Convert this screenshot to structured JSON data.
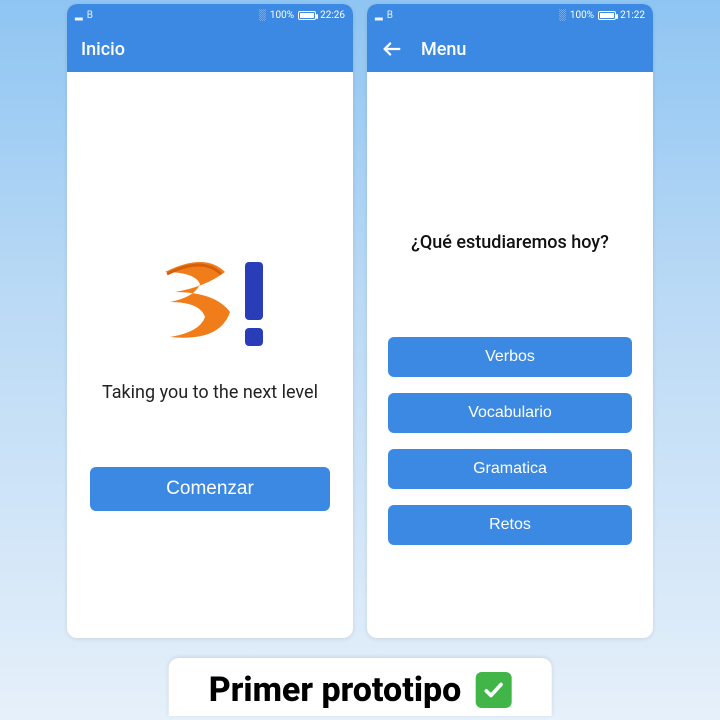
{
  "phone1": {
    "status": {
      "left": "B",
      "battery": "100%",
      "time": "22:26"
    },
    "appbar": {
      "title": "Inicio"
    },
    "tagline": "Taking you to the next level",
    "start_button": "Comenzar"
  },
  "phone2": {
    "status": {
      "left": "B",
      "battery": "100%",
      "time": "21:22"
    },
    "appbar": {
      "title": "Menu"
    },
    "question": "¿Qué estudiaremos hoy?",
    "options": [
      "Verbos",
      "Vocabulario",
      "Gramatica",
      "Retos"
    ]
  },
  "caption": "Primer prototipo"
}
